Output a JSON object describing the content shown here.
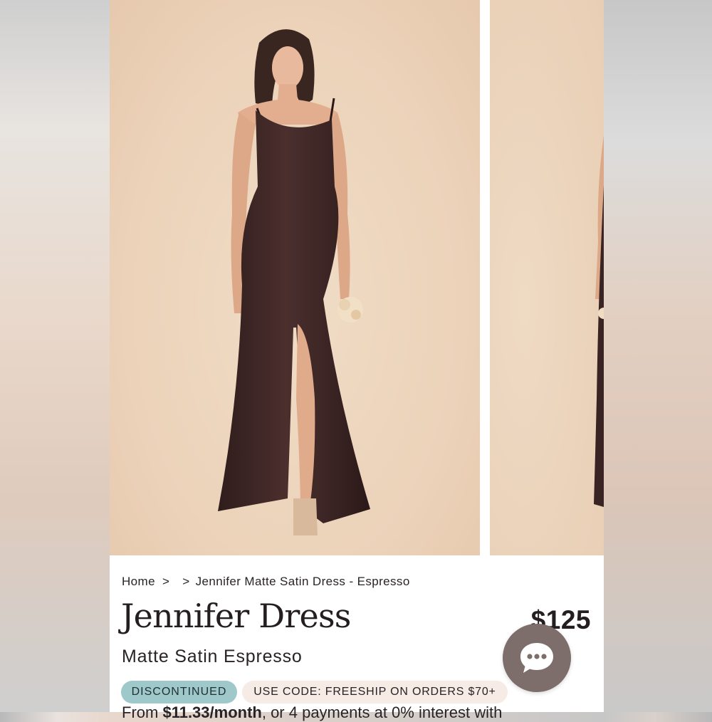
{
  "breadcrumb": {
    "home": "Home",
    "sep1": ">",
    "sep2": ">",
    "current": "Jennifer Matte Satin Dress - Espresso"
  },
  "product": {
    "title": "Jennifer Dress",
    "subtitle": "Matte Satin Espresso",
    "price": "$125"
  },
  "badges": {
    "status": "DISCONTINUED",
    "promo": "USE CODE: FREESHIP ON ORDERS $70+"
  },
  "financing": {
    "prefix": "From ",
    "amount": "$11.33/month",
    "suffix": ", or 4 payments at 0% interest with"
  },
  "chat": {
    "icon": "chat-bubble-icon"
  },
  "colors": {
    "dress": "#3b2524",
    "backdrop": "#ecd3ba",
    "badge_discontinued": "#9fc8ca",
    "badge_promo": "#f6ece5",
    "chat_button": "#7d6d6b"
  }
}
